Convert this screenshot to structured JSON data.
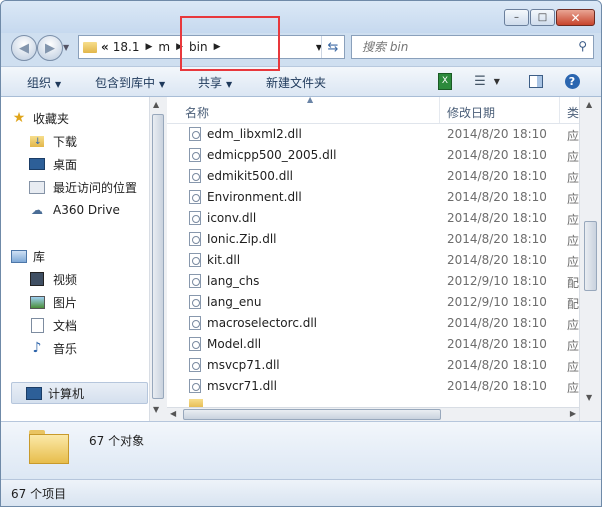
{
  "window": {
    "minimize": "–",
    "maximize": "□",
    "close": "✕"
  },
  "address": {
    "overflow": "«",
    "segments": [
      "18.1",
      "m",
      "bin"
    ]
  },
  "search": {
    "placeholder": "搜索 bin"
  },
  "toolbar": {
    "organize": "组织",
    "include_in_library": "包含到库中",
    "share": "共享",
    "new_folder": "新建文件夹"
  },
  "sidebar": {
    "favorites": {
      "label": "收藏夹",
      "items": [
        "下载",
        "桌面",
        "最近访问的位置",
        "A360 Drive"
      ]
    },
    "libraries": {
      "label": "库",
      "items": [
        "视频",
        "图片",
        "文档",
        "音乐"
      ]
    },
    "computer": {
      "label": "计算机"
    }
  },
  "columns": {
    "name": "名称",
    "date": "修改日期",
    "type": "类"
  },
  "files": [
    {
      "name": "edm_libxml2.dll",
      "date": "2014/8/20 18:10",
      "type": "应"
    },
    {
      "name": "edmicpp500_2005.dll",
      "date": "2014/8/20 18:10",
      "type": "应"
    },
    {
      "name": "edmikit500.dll",
      "date": "2014/8/20 18:10",
      "type": "应"
    },
    {
      "name": "Environment.dll",
      "date": "2014/8/20 18:10",
      "type": "应"
    },
    {
      "name": "iconv.dll",
      "date": "2014/8/20 18:10",
      "type": "应"
    },
    {
      "name": "Ionic.Zip.dll",
      "date": "2014/8/20 18:10",
      "type": "应"
    },
    {
      "name": "kit.dll",
      "date": "2014/8/20 18:10",
      "type": "应"
    },
    {
      "name": "lang_chs",
      "date": "2012/9/10 18:10",
      "type": "配"
    },
    {
      "name": "lang_enu",
      "date": "2012/9/10 18:10",
      "type": "配"
    },
    {
      "name": "macroselectorc.dll",
      "date": "2014/8/20 18:10",
      "type": "应"
    },
    {
      "name": "Model.dll",
      "date": "2014/8/20 18:10",
      "type": "应"
    },
    {
      "name": "msvcp71.dll",
      "date": "2014/8/20 18:10",
      "type": "应"
    },
    {
      "name": "msvcr71.dll",
      "date": "2014/8/20 18:10",
      "type": "应"
    }
  ],
  "details": {
    "count": "67 个对象"
  },
  "status": {
    "count": "67 个项目"
  }
}
